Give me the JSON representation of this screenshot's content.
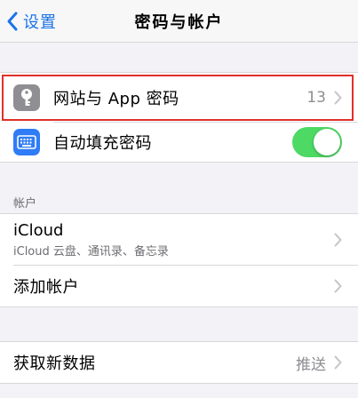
{
  "nav": {
    "back_label": "设置",
    "title": "密码与帐户"
  },
  "passwords_group": {
    "website_passwords": {
      "label": "网站与 App 密码",
      "count": "13"
    },
    "autofill": {
      "label": "自动填充密码",
      "enabled": true
    }
  },
  "accounts_section": {
    "header": "帐户",
    "icloud": {
      "title": "iCloud",
      "subtitle": "iCloud 云盘、通讯录、备忘录"
    },
    "add_account": {
      "label": "添加帐户"
    }
  },
  "fetch_group": {
    "fetch_new_data": {
      "label": "获取新数据",
      "value": "推送"
    }
  },
  "colors": {
    "accent": "#1a73e8",
    "toggle_on": "#4cd964",
    "highlight": "#e0302a"
  }
}
